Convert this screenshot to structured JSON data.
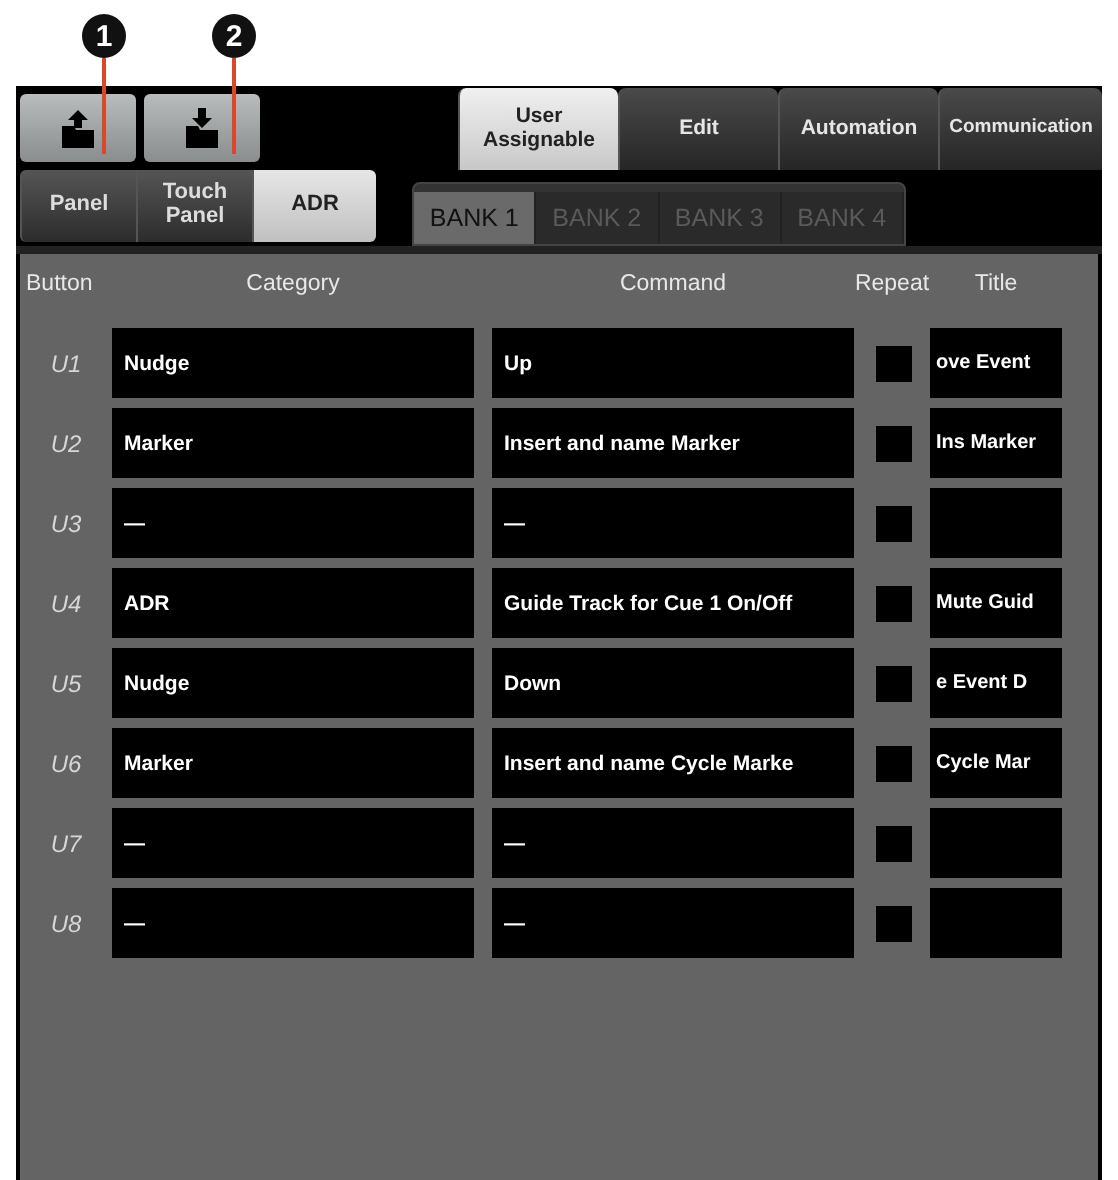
{
  "callouts": [
    "1",
    "2"
  ],
  "file_buttons": [
    {
      "kind": "export"
    },
    {
      "kind": "import"
    }
  ],
  "main_tabs": [
    {
      "label": "User Assignable",
      "selected": true
    },
    {
      "label": "Edit",
      "selected": false
    },
    {
      "label": "Automation",
      "selected": false
    },
    {
      "label": "Communication",
      "selected": false
    }
  ],
  "sub_tabs": [
    {
      "label": "Panel",
      "selected": false
    },
    {
      "label": "Touch Panel",
      "selected": false
    },
    {
      "label": "ADR",
      "selected": true
    }
  ],
  "bank_tabs": [
    {
      "label": "BANK 1",
      "selected": true
    },
    {
      "label": "BANK 2",
      "selected": false
    },
    {
      "label": "BANK 3",
      "selected": false
    },
    {
      "label": "BANK 4",
      "selected": false
    }
  ],
  "table": {
    "columns": [
      "Button",
      "Category",
      "Command",
      "Repeat",
      "Title"
    ],
    "rows": [
      {
        "button": "U1",
        "category": "Nudge",
        "command": "Up",
        "repeat": false,
        "title": "ove Event"
      },
      {
        "button": "U2",
        "category": "Marker",
        "command": "Insert and name Marker",
        "repeat": false,
        "title": "Ins Marker"
      },
      {
        "button": "U3",
        "category": "—",
        "command": "—",
        "repeat": false
      },
      {
        "button": "U4",
        "category": "ADR",
        "command": "Guide Track for Cue 1 On/Off",
        "repeat": false,
        "title": "Mute Guid"
      },
      {
        "button": "U5",
        "category": "Nudge",
        "command": "Down",
        "repeat": false,
        "title": "e Event D"
      },
      {
        "button": "U6",
        "category": "Marker",
        "command": "Insert and name Cycle Marke",
        "repeat": false,
        "title": "Cycle Mar"
      },
      {
        "button": "U7",
        "category": "—",
        "command": "—",
        "repeat": false
      },
      {
        "button": "U8",
        "category": "—",
        "command": "—",
        "repeat": false
      }
    ]
  }
}
